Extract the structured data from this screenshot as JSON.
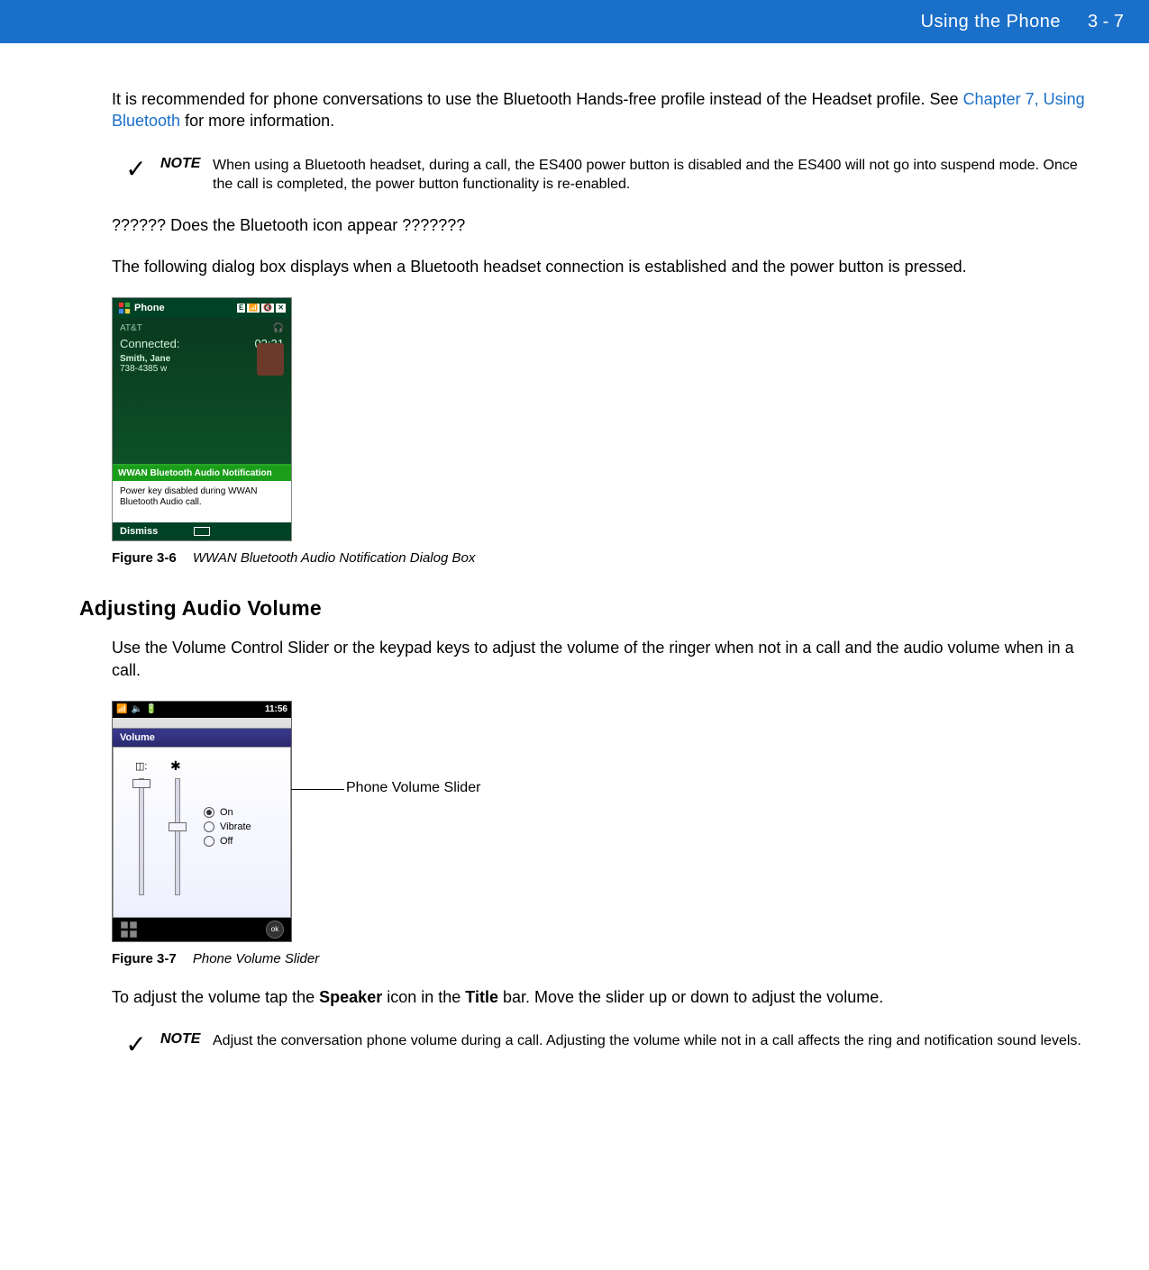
{
  "header": {
    "title": "Using the Phone",
    "page": "3 - 7"
  },
  "intro": {
    "p1a": "It is recommended for phone conversations to use the Bluetooth Hands-free profile instead of the Headset profile. See ",
    "p1link": "Chapter 7, Using Bluetooth",
    "p1b": " for more information."
  },
  "note1": {
    "label": "NOTE",
    "text": "When using a Bluetooth headset, during a call, the ES400 power button is disabled and the ES400 will not go into suspend mode. Once the call is completed, the power button functionality is re-enabled."
  },
  "q": "?????? Does the Bluetooth icon appear ???????",
  "p2": "The following dialog box displays when a Bluetooth headset connection is established and the power button is pressed.",
  "fig6": {
    "title": "Phone",
    "badge": "E",
    "carrier": "AT&T",
    "connected": "Connected:",
    "time": "02:21",
    "name": "Smith, Jane",
    "phone": "738-4385 w",
    "notif_title": "WWAN Bluetooth Audio Notification",
    "notif_body": "Power key disabled during WWAN Bluetooth Audio call.",
    "dismiss": "Dismiss",
    "caption_num": "Figure 3-6",
    "caption_text": "WWAN Bluetooth Audio Notification Dialog Box"
  },
  "section": {
    "h": "Adjusting Audio Volume"
  },
  "p3": "Use the Volume Control Slider or the keypad keys to adjust the volume of the ringer when not in a call and the audio volume when in a call.",
  "fig7": {
    "time": "11:56",
    "vol_title": "Volume",
    "radio1": "On",
    "radio2": "Vibrate",
    "radio3": "Off",
    "ok": "ok",
    "callout": "Phone Volume Slider",
    "caption_num": "Figure 3-7",
    "caption_text": "Phone Volume Slider"
  },
  "p4a": "To adjust the volume tap the ",
  "p4b": "Speaker",
  "p4c": " icon in the ",
  "p4d": "Title",
  "p4e": " bar. Move the slider up or down to adjust the volume.",
  "note2": {
    "label": "NOTE",
    "text": "Adjust the conversation phone volume during a call. Adjusting the volume while not in a call affects the ring and notification sound levels."
  }
}
